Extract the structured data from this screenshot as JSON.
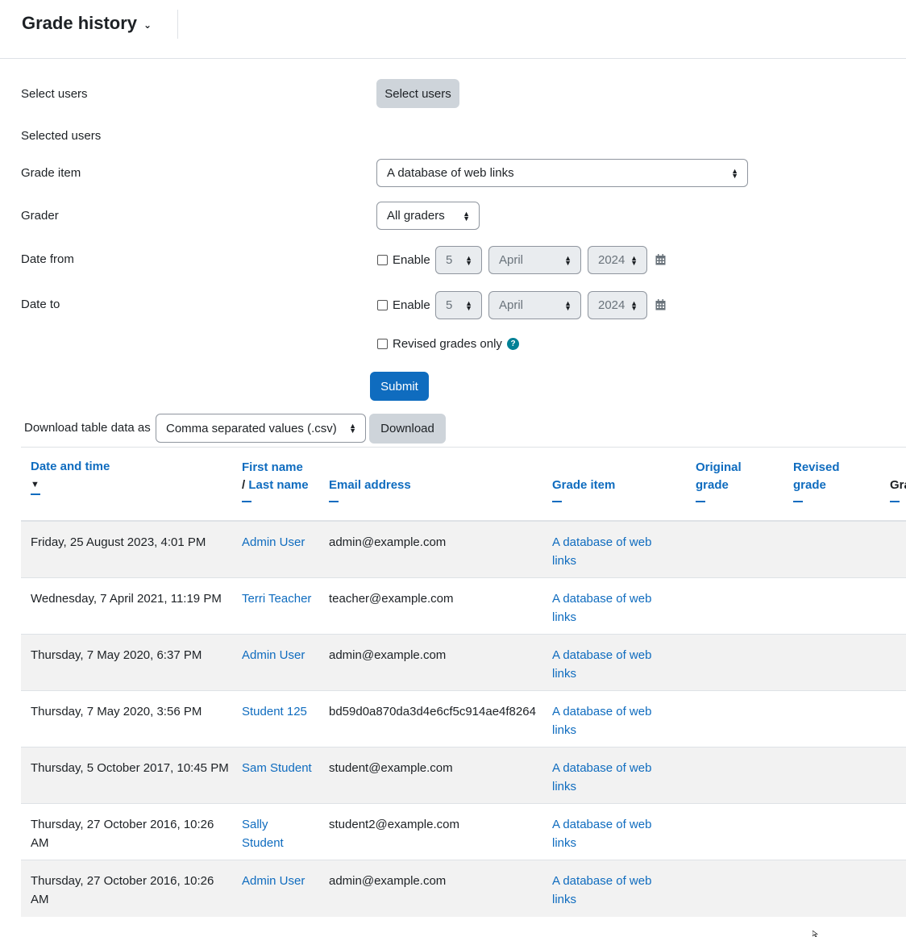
{
  "header": {
    "title": "Grade history"
  },
  "form": {
    "select_users_label": "Select users",
    "select_users_button": "Select users",
    "selected_users_label": "Selected users",
    "grade_item_label": "Grade item",
    "grade_item_value": "A database of web links",
    "grader_label": "Grader",
    "grader_value": "All graders",
    "date_from_label": "Date from",
    "date_from": {
      "enable": "Enable",
      "day": "5",
      "month": "April",
      "year": "2024"
    },
    "date_to_label": "Date to",
    "date_to": {
      "enable": "Enable",
      "day": "5",
      "month": "April",
      "year": "2024"
    },
    "revised_label": "Revised grades only",
    "help_glyph": "?",
    "submit": "Submit"
  },
  "download": {
    "label": "Download table data as",
    "format": "Comma separated values (.csv)",
    "button": "Download"
  },
  "table": {
    "headers": {
      "date_time": "Date and time",
      "first_name": "First name",
      "last_name": "Last name",
      "email": "Email address",
      "grade_item": "Grade item",
      "original_1": "Original",
      "original_2": "grade",
      "revised_1": "Revised",
      "revised_2": "grade",
      "grade_partial": "Gra"
    },
    "rows": [
      {
        "date": "Friday, 25 August 2023, 4:01 PM",
        "name": "Admin User",
        "email": "admin@example.com",
        "item": "A database of web links"
      },
      {
        "date": "Wednesday, 7 April 2021, 11:19 PM",
        "name": "Terri Teacher",
        "email": "teacher@example.com",
        "item": "A database of web links"
      },
      {
        "date": "Thursday, 7 May 2020, 6:37 PM",
        "name": "Admin User",
        "email": "admin@example.com",
        "item": "A database of web links"
      },
      {
        "date": "Thursday, 7 May 2020, 3:56 PM",
        "name": "Student 125",
        "email": "bd59d0a870da3d4e6cf5c914ae4f8264",
        "item": "A database of web links"
      },
      {
        "date": "Thursday, 5 October 2017, 10:45 PM",
        "name": "Sam Student",
        "email": "student@example.com",
        "item": "A database of web links"
      },
      {
        "date": "Thursday, 27 October 2016, 10:26 AM",
        "name": "Sally Student",
        "email": "student2@example.com",
        "item": "A database of web links"
      },
      {
        "date": "Thursday, 27 October 2016, 10:26 AM",
        "name": "Admin User",
        "email": "admin@example.com",
        "item": "A database of web links"
      }
    ]
  },
  "colors": {
    "accent": "#0f6cbf",
    "row_stripe": "#f2f2f2",
    "border": "#dee2e6"
  }
}
